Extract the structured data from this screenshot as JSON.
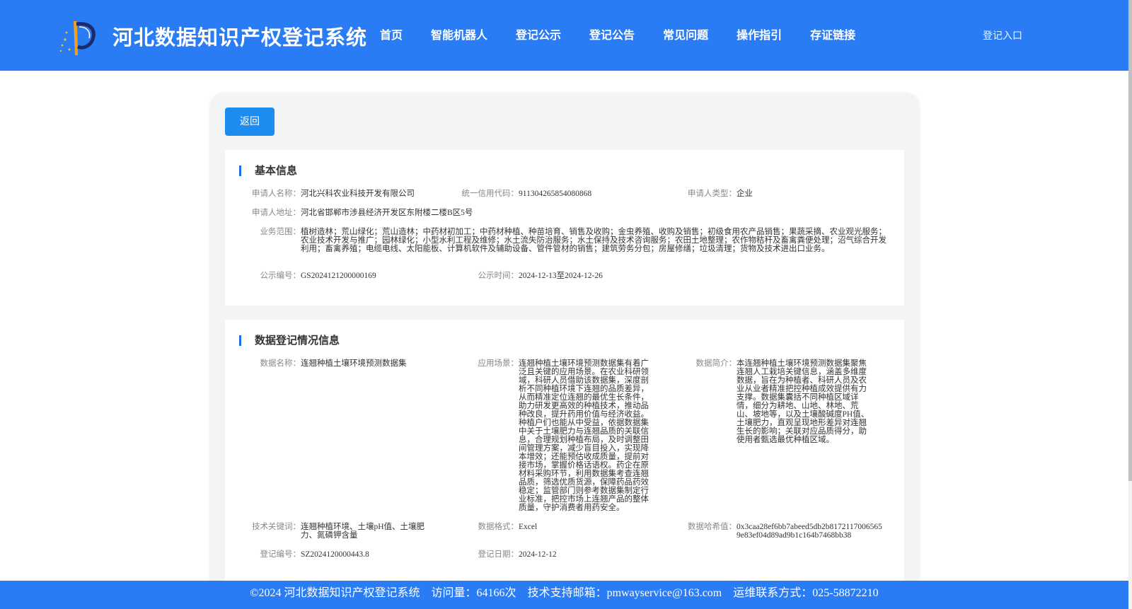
{
  "header": {
    "title": "河北数据知识产权登记系统",
    "nav": [
      "首页",
      "智能机器人",
      "登记公示",
      "登记公告",
      "常见问题",
      "操作指引",
      "存证链接"
    ],
    "login": "登记入口"
  },
  "back_button": "返回",
  "basic": {
    "title": "基本信息",
    "applicant_name_label": "申请人名称：",
    "applicant_name": "河北兴科农业科技开发有限公司",
    "credit_code_label": "统一信用代码：",
    "credit_code": "911304265854080868",
    "applicant_type_label": "申请人类型：",
    "applicant_type": "企业",
    "address_label": "申请人地址：",
    "address": "河北省邯郸市涉县经济开发区东附楼二楼B区5号",
    "business_label": "业务范围：",
    "business": "植树造林；荒山绿化；荒山造林；中药材初加工；中药材种植、种苗培育、销售及收购；金虫养殖、收购及销售；初级食用农产品销售；果蔬采摘、农业观光服务；农业技术开发与推广；园林绿化；小型水利工程及维修；水土流失防治服务；水土保持及技术咨询服务；农田土地整理；农作物秸秆及畜禽粪便处理；沼气综合开发利用；畜禽养殖；电缆电线、太阳能板、计算机软件及辅助设备、管件管材的销售；建筑劳务分包；房屋修缮；垃圾清理；货物及技术进出口业务。",
    "pub_no_label": "公示编号：",
    "pub_no": "GS2024121200000169",
    "pub_time_label": "公示时间：",
    "pub_time": "2024-12-13至2024-12-26"
  },
  "data_info": {
    "title": "数据登记情况信息",
    "name_label": "数据名称：",
    "name": "连翘种植土壤环境预测数据集",
    "scenario_label": "应用场景：",
    "scenario": "连翘种植土壤环境预测数据集有着广泛且关键的应用场景。在农业科研领域，科研人员借助该数据集，深度剖析不同种植环境下连翘的品质差异，从而精准定位连翘的最优生长条件，助力研发更高效的种植技术，推动品种改良，提升药用价值与经济收益。种植户们也能从中受益，依据数据集中关于土壤肥力与连翘品质的关联信息，合理规划种植布局，及时调整田间管理方案，减少盲目投入，实现降本增效；还能预估收成质量，提前对接市场，掌握价格话语权。药企在原材料采购环节，利用数据集考查连翘品质，筛选优质货源，保障药品药效稳定；监管部门则参考数据集制定行业标准，把控市场上连翘产品的整体质量，守护消费者用药安全。",
    "intro_label": "数据简介：",
    "intro": "本连翘种植土壤环境预测数据集聚焦连翘人工栽培关键信息，涵盖多维度数据，旨在为种植者、科研人员及农业从业者精准把控种植成效提供有力支撑。数据集囊括不同种植区域详情，细分为耕地、山地、林地、荒山、坡地等，以及土壤酸碱度PH值、土壤肥力，直观呈现地形差异对连翘生长的影响；关联对应品质得分，助使用者甄选最优种植区域。",
    "keywords_label": "技术关键词：",
    "keywords": "连翘种植环境、土壤pH值、土壤肥力、氮磷钾含量",
    "format_label": "数据格式：",
    "format": "Excel",
    "hash_label": "数据哈希值：",
    "hash": "0x3caa28ef6bb7abeed5db2b81721170065659e83ef04d89ad9b1c164b7468bb38",
    "reg_no_label": "登记编号：",
    "reg_no": "SZ2024120000443.8",
    "reg_date_label": "登记日期：",
    "reg_date": "2024-12-12"
  },
  "footer": {
    "copyright": "©2024 河北数据知识产权登记系统",
    "visits": "访问量：64166次",
    "email": "技术支持邮箱：pmwayservice@163.com",
    "phone": "运维联系方式：025-58872210"
  },
  "colors": {
    "brand_blue": "#2a7cf5",
    "button_blue": "#1d8cf0"
  }
}
